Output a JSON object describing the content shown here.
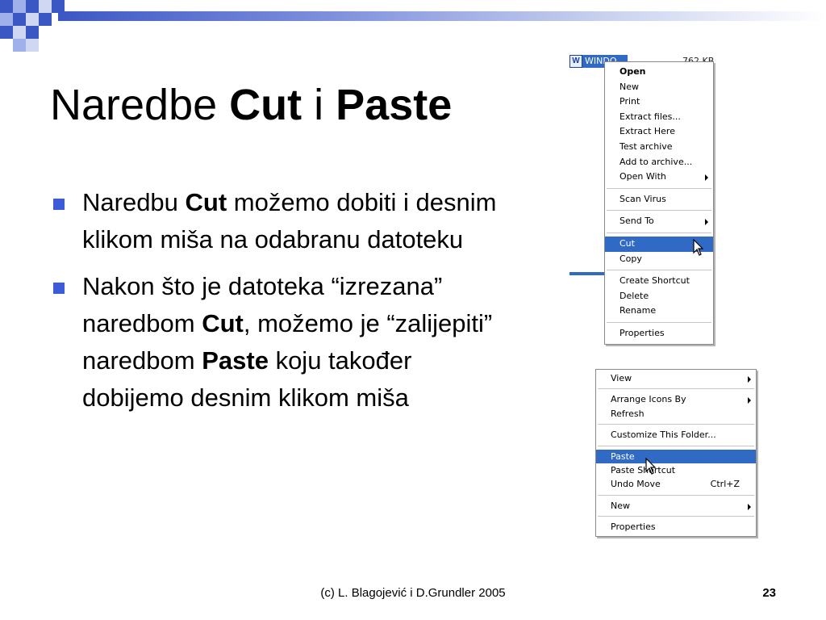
{
  "slide": {
    "title_plain_1": "Naredbe ",
    "title_bold_1": "Cut",
    "title_plain_2": " i ",
    "title_bold_2": "Paste",
    "bullets": [
      {
        "part1": "Naredbu ",
        "bold1": "Cut",
        "part2": " možemo dobiti i desnim klikom miša na odabranu datoteku"
      },
      {
        "part1": "Nakon što je datoteka “izrezana” naredbom ",
        "bold1": "Cut",
        "part2": ", možemo je “zalijepiti” naredbom ",
        "bold2": "Paste",
        "part3": " koju također dobijemo desnim klikom miša"
      }
    ],
    "footer": "(c) L. Blagojević i D.Grundler 2005",
    "page_number": "23"
  },
  "screenshot_file_menu": {
    "file_icon": "W",
    "file_name": "WINDO...",
    "file_size": "762 KB",
    "items": [
      {
        "label": "Open",
        "bold": true
      },
      {
        "label": "New"
      },
      {
        "label": "Print"
      },
      {
        "label": "Extract files..."
      },
      {
        "label": "Extract Here"
      },
      {
        "label": "Test archive"
      },
      {
        "label": "Add to archive..."
      },
      {
        "label": "Open With",
        "submenu": true
      },
      {
        "separator": true
      },
      {
        "label": "Scan Virus"
      },
      {
        "separator": true
      },
      {
        "label": "Send To",
        "submenu": true
      },
      {
        "separator": true
      },
      {
        "label": "Cut",
        "selected": true
      },
      {
        "label": "Copy"
      },
      {
        "separator": true
      },
      {
        "label": "Create Shortcut"
      },
      {
        "label": "Delete"
      },
      {
        "label": "Rename"
      },
      {
        "separator": true
      },
      {
        "label": "Properties"
      }
    ]
  },
  "screenshot_folder_menu": {
    "items": [
      {
        "label": "View",
        "submenu": true
      },
      {
        "separator": true
      },
      {
        "label": "Arrange Icons By",
        "submenu": true
      },
      {
        "label": "Refresh"
      },
      {
        "separator": true
      },
      {
        "label": "Customize This Folder..."
      },
      {
        "separator": true
      },
      {
        "label": "Paste",
        "selected": true
      },
      {
        "label": "Paste Shortcut"
      },
      {
        "label": "Undo Move",
        "shortcut": "Ctrl+Z"
      },
      {
        "separator": true
      },
      {
        "label": "New",
        "submenu": true
      },
      {
        "separator": true
      },
      {
        "label": "Properties"
      }
    ]
  },
  "colors": {
    "accent": "#3c5bd6",
    "selection": "#316ac5"
  }
}
